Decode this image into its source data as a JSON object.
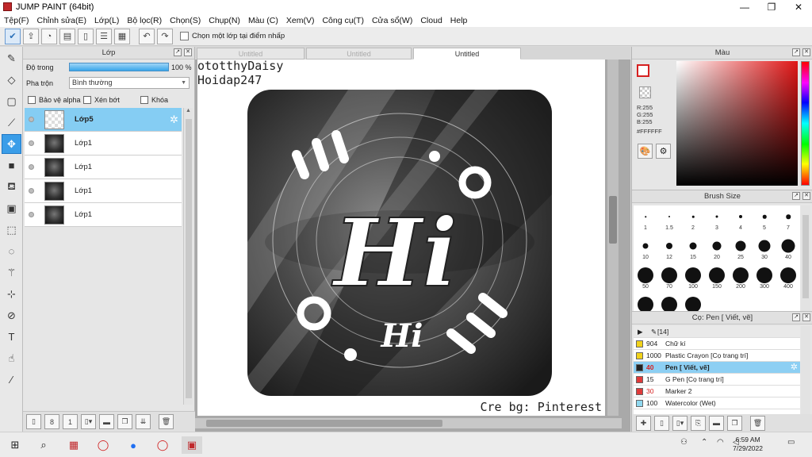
{
  "window": {
    "title": "JUMP PAINT (64bit)",
    "controls": [
      "—",
      "❐",
      "✕"
    ]
  },
  "menu": [
    "Tệp(F)",
    "Chỉnh sửa(E)",
    "Lớp(L)",
    "Bộ lọc(R)",
    "Chọn(S)",
    "Chụp(N)",
    "Màu (C)",
    "Xem(V)",
    "Công cụ(T)",
    "Cửa sổ(W)",
    "Cloud",
    "Help"
  ],
  "toolbar": {
    "checkbox_label": "Chọn một lớp tại điểm nhấp"
  },
  "layer_panel": {
    "title": "Lớp",
    "opacity_label": "Độ trong",
    "opacity_value": "100 %",
    "opacity_fraction": 1.0,
    "blend_label": "Pha trộn",
    "blend_value": "Bình thường",
    "checks": [
      "Bảo vệ alpha",
      "Xén bớt",
      "Khóa"
    ],
    "layers": [
      {
        "name": "Lớp5",
        "selected": true
      },
      {
        "name": "Lớp1",
        "selected": false
      },
      {
        "name": "Lớp1",
        "selected": false
      },
      {
        "name": "Lớp1",
        "selected": false
      },
      {
        "name": "Lớp1",
        "selected": false
      }
    ]
  },
  "tabs": [
    "Untitled",
    "Untitled",
    "Untitled"
  ],
  "canvas": {
    "credit_top": "ototthyDaisy\nHoidap247",
    "credit_bottom": "Cre bg: Pinterest",
    "art_title": "Hi",
    "art_subtitle": "Hi"
  },
  "color_panel": {
    "title": "Màu",
    "rgb": [
      "R:255",
      "G:255",
      "B:255"
    ],
    "hex": "#FFFFFF",
    "foreground": "#ffffff",
    "accent": "#d62020"
  },
  "brush_panel": {
    "title": "Brush Size",
    "sizes": [
      "1",
      "1.5",
      "2",
      "3",
      "4",
      "5",
      "7",
      "10",
      "12",
      "15",
      "20",
      "25",
      "30",
      "40",
      "50",
      "70",
      "100",
      "150",
      "200",
      "300",
      "400",
      "",
      "",
      ""
    ]
  },
  "pen_panel": {
    "title": "Cọ: Pen [ Viết, vẽ]",
    "group_label": "[14]",
    "items": [
      {
        "num": "904",
        "name": "Chữ kí",
        "color": "#f1d21a",
        "selected": false
      },
      {
        "num": "1000",
        "name": "Plastic Crayon [Cọ trang trí]",
        "color": "#f1d21a",
        "selected": false
      },
      {
        "num": "40",
        "name": "Pen [ Viết, vẽ]",
        "color": "#222222",
        "selected": true
      },
      {
        "num": "15",
        "name": "G Pen [Cọ trang trí]",
        "color": "#e03a3a",
        "selected": false
      },
      {
        "num": "30",
        "name": "Marker 2",
        "color": "#e03a3a",
        "selected": false
      },
      {
        "num": "100",
        "name": "Watercolor (Wet)",
        "color": "#8fd8f0",
        "selected": false
      }
    ]
  },
  "taskbar": {
    "time": "6:59 AM",
    "date": "7/29/2022"
  }
}
